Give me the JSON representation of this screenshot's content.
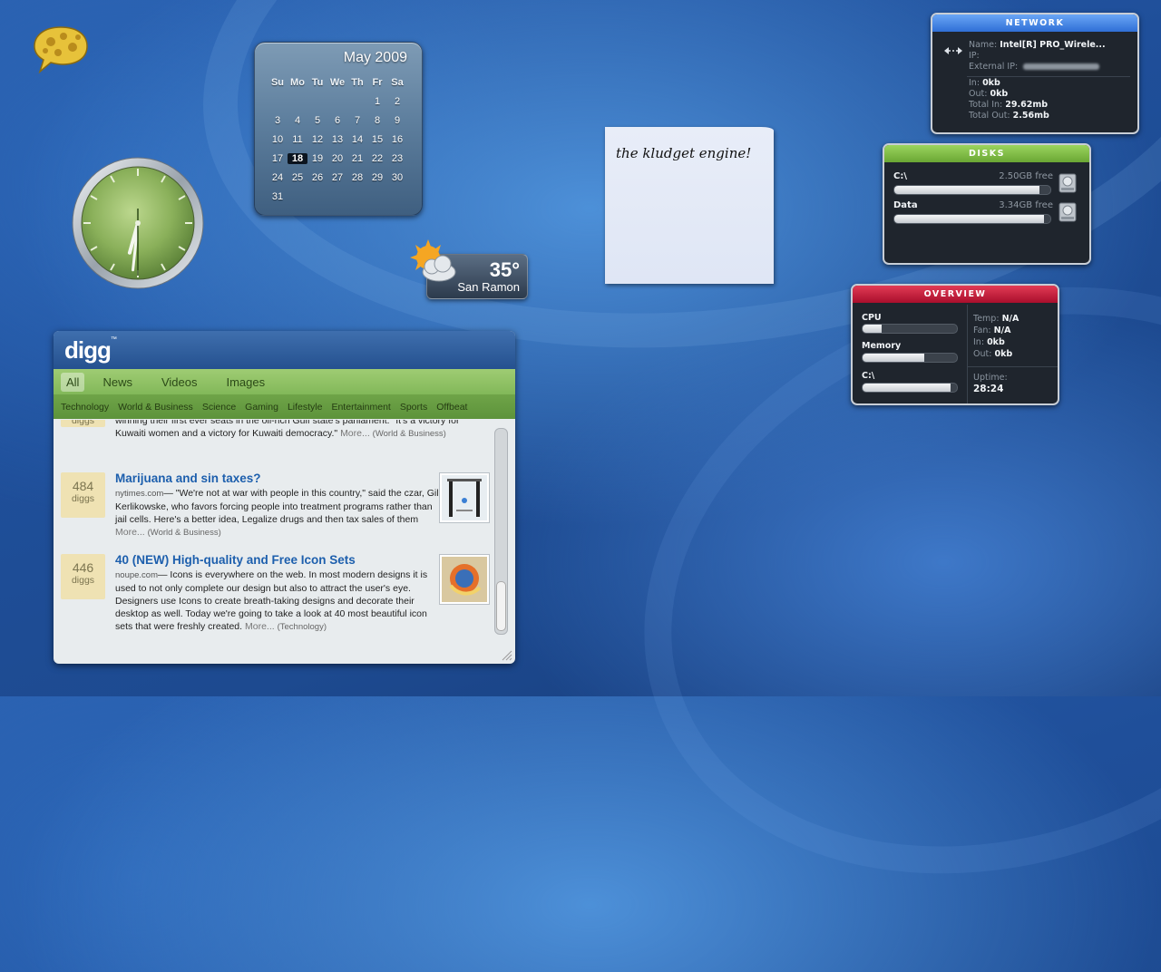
{
  "calendar": {
    "title": "May 2009",
    "weekdays": [
      "Su",
      "Mo",
      "Tu",
      "We",
      "Th",
      "Fr",
      "Sa"
    ],
    "weeks": [
      [
        "",
        "",
        "",
        "",
        "",
        "1",
        "2"
      ],
      [
        "3",
        "4",
        "5",
        "6",
        "7",
        "8",
        "9"
      ],
      [
        "10",
        "11",
        "12",
        "13",
        "14",
        "15",
        "16"
      ],
      [
        "17",
        "18",
        "19",
        "20",
        "21",
        "22",
        "23"
      ],
      [
        "24",
        "25",
        "26",
        "27",
        "28",
        "29",
        "30"
      ],
      [
        "31",
        "",
        "",
        "",
        "",
        "",
        ""
      ]
    ],
    "today": "18"
  },
  "clock": {
    "hour": 6,
    "minute": 31
  },
  "weather": {
    "temp": "35°",
    "city": "San Ramon"
  },
  "note": {
    "text": "the kludget engine!"
  },
  "digg": {
    "logo": "digg",
    "logo_tm": "™",
    "tabs": [
      "All",
      "News",
      "Videos",
      "Images"
    ],
    "active_tab": "All",
    "categories": [
      "Technology",
      "World & Business",
      "Science",
      "Gaming",
      "Lifestyle",
      "Entertainment",
      "Sports",
      "Offbeat"
    ],
    "items": [
      {
        "badge_label": "diggs",
        "text": "winning their first ever seats in the oil-rich Gulf state's parliament. \"It's a victory for Kuwaiti women and a victory for Kuwaiti democracy.\"",
        "more": "More...",
        "category": "(World & Business)"
      },
      {
        "count": "484",
        "badge_label": "diggs",
        "title": "Marijuana and sin taxes?",
        "source": "nytimes.com",
        "text": "— \"We're not at war with people in this country,\" said the czar, Gil Kerlikowske, who favors forcing people into treatment programs rather than jail cells. Here's a better idea, Legalize drugs and then tax sales of them",
        "more": "More...",
        "category": "(World & Business)"
      },
      {
        "count": "446",
        "badge_label": "diggs",
        "title": "40 (NEW) High-quality and Free Icon Sets",
        "source": "noupe.com",
        "text": "— Icons is everywhere on the web. In most modern designs it is used to not only complete our design but also to attract the user's eye. Designers use Icons to create breath-taking designs and decorate their desktop as well. Today we're going to take a look at 40 most beautiful icon sets that were freshly created.",
        "more": "More...",
        "category": "(Technology)"
      }
    ]
  },
  "network": {
    "title": "NETWORK",
    "name_label": "Name:",
    "name_value": "Intel[R] PRO_Wirele...",
    "ip_label": "IP:",
    "external_ip_label": "External IP:",
    "in_label": "In:",
    "in_value": "0kb",
    "out_label": "Out:",
    "out_value": "0kb",
    "total_in_label": "Total In:",
    "total_in_value": "29.62mb",
    "total_out_label": "Total Out:",
    "total_out_value": "2.56mb"
  },
  "disks": {
    "title": "DISKS",
    "items": [
      {
        "name": "C:\\",
        "free": "2.50GB free",
        "used_fraction": 0.93
      },
      {
        "name": "Data",
        "free": "3.34GB free",
        "used_fraction": 0.96
      }
    ]
  },
  "overview": {
    "title": "OVERVIEW",
    "cpu_label": "CPU",
    "cpu_fraction": 0.2,
    "memory_label": "Memory",
    "memory_fraction": 0.65,
    "disk_label": "C:\\",
    "disk_fraction": 0.93,
    "temp_label": "Temp:",
    "temp_value": "N/A",
    "fan_label": "Fan:",
    "fan_value": "N/A",
    "in_label": "In:",
    "in_value": "0kb",
    "out_label": "Out:",
    "out_value": "0kb",
    "uptime_label": "Uptime:",
    "uptime_value": "28:24"
  }
}
